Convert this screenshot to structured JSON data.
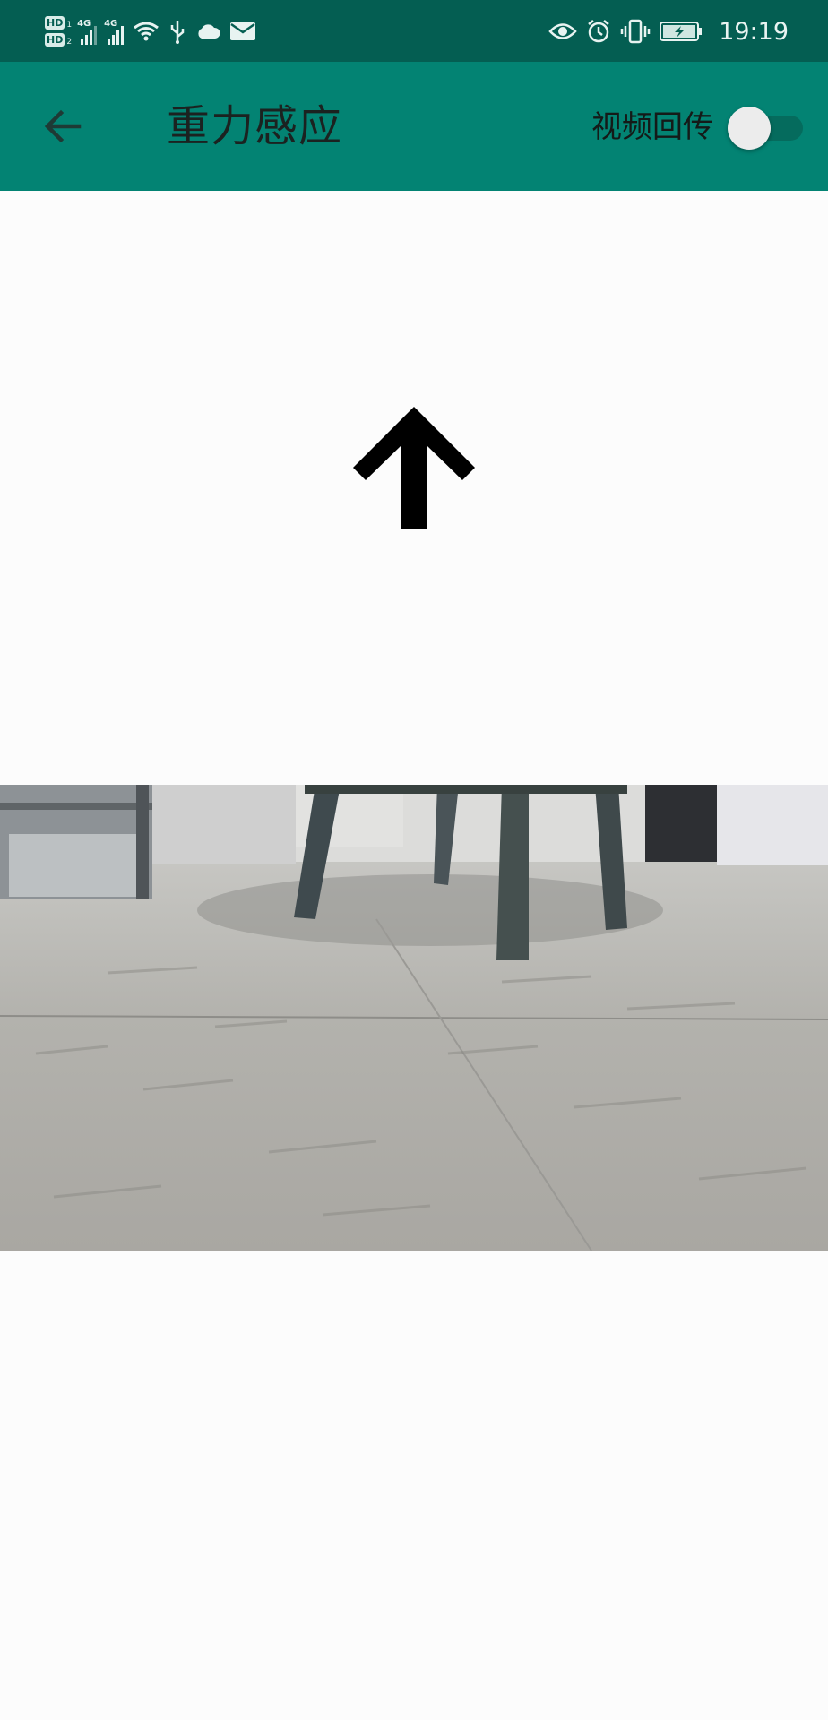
{
  "status_bar": {
    "sim1_badge": "HD",
    "sim1_index": "1",
    "sim2_badge": "HD",
    "sim2_index": "2",
    "net1": "4G",
    "net2": "4G",
    "time": "19:19",
    "icons": [
      "signal-icon",
      "wifi-icon",
      "usb-icon",
      "cloud-icon",
      "mail-icon",
      "eye-icon",
      "alarm-icon",
      "vibrate-icon",
      "battery-charging-icon"
    ]
  },
  "app_bar": {
    "title": "重力感应",
    "toggle_label": "视频回传",
    "toggle_on": false,
    "colors": {
      "bar": "#038373",
      "status": "#045e52"
    }
  },
  "direction": {
    "icon": "arrow-up-icon"
  },
  "camera": {
    "scene": "video-feed"
  }
}
